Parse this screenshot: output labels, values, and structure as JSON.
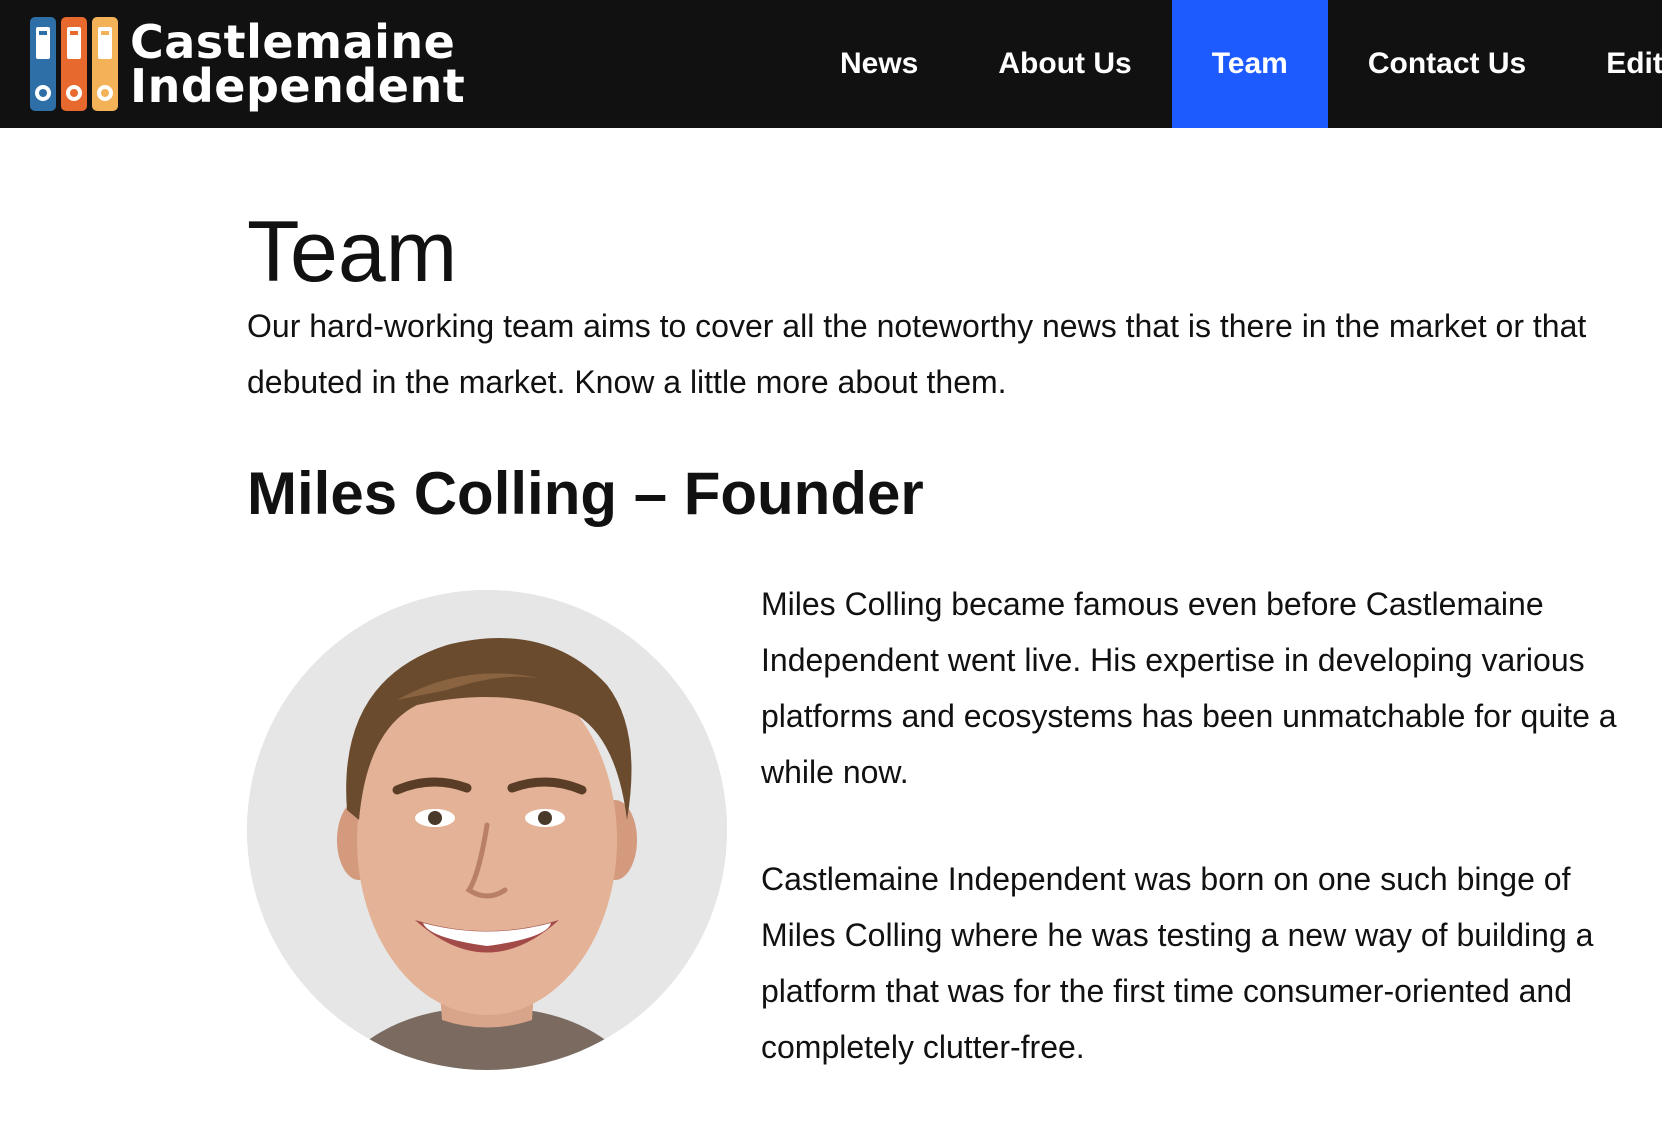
{
  "header": {
    "logo": {
      "line1": "Castlemaine",
      "line2": "Independent",
      "icon": "binders-logo-icon"
    },
    "nav": [
      {
        "label": "News",
        "active": false
      },
      {
        "label": "About Us",
        "active": false
      },
      {
        "label": "Team",
        "active": true
      },
      {
        "label": "Contact Us",
        "active": false
      },
      {
        "label": "Edito",
        "active": false
      }
    ]
  },
  "colors": {
    "header_bg": "#111111",
    "active_nav": "#1e5bff",
    "binder_blue": "#2f6fa8",
    "binder_orange": "#e8692e",
    "binder_yellow": "#f3b158"
  },
  "main": {
    "title": "Team",
    "intro_lines": [
      "Our hard-working team aims to cover all the noteworthy news that is there in the market or that",
      "debuted in the market. Know a little more about them."
    ],
    "member": {
      "name": "Miles Colling – Founder",
      "photo": "portrait-photo",
      "bio_paragraphs": [
        [
          "Miles Colling became famous even before Castlemaine",
          "Independent went live. His expertise in developing various",
          "platforms and ecosystems has been unmatchable for quite a",
          "while now."
        ],
        [
          "Castlemaine Independent was born on one such binge of",
          "Miles Colling where he was testing a new way of building a",
          "platform that was for the first time consumer-oriented and",
          "completely clutter-free."
        ]
      ]
    }
  }
}
